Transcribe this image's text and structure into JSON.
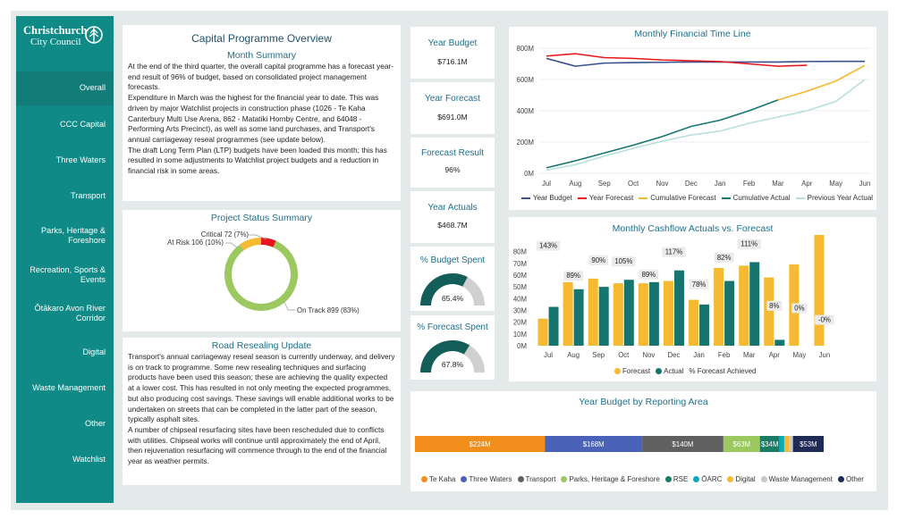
{
  "brand": {
    "line1": "Christchurch",
    "line2": "City Council"
  },
  "nav": [
    {
      "label": "Overall",
      "active": true
    },
    {
      "label": "CCC Capital"
    },
    {
      "label": "Three Waters"
    },
    {
      "label": "Transport"
    },
    {
      "label": "Parks, Heritage & Foreshore"
    },
    {
      "label": "Recreation, Sports & Events"
    },
    {
      "label": "Ōtākaro Avon River Corridor"
    },
    {
      "label": "Digital"
    },
    {
      "label": "Waste Management"
    },
    {
      "label": "Other"
    },
    {
      "label": "Watchlist"
    }
  ],
  "overview": {
    "title": "Capital Programme Overview",
    "month_summary_title": "Month Summary",
    "p1": "At the end of the third quarter, the overall capital programme has a forecast year-end result of 96% of budget, based on consolidated project management forecasts.",
    "p2": "Expenditure in March was the highest for the financial year to date. This was driven by major Watchlist projects in construction phase (1026 - Te Kaha Canterbury Multi Use Arena, 862 - Matatiki Hornby Centre, and 64048 - Performing Arts Precinct), as well as some land purchases, and Transport's annual carriageway reseal programmes (see update below).",
    "p3": "The draft Long Term Plan (LTP) budgets have been loaded this month; this has resulted in some adjustments to Watchlist project budgets and a reduction in financial risk in some areas."
  },
  "project_status": {
    "title": "Project Status Summary",
    "labels": {
      "critical": "Critical 72 (7%)",
      "at_risk": "At Risk 106 (10%)",
      "on_track": "On Track 899 (83%)"
    },
    "values": {
      "on_track": 899,
      "at_risk": 106,
      "critical": 72
    },
    "colors": {
      "on_track": "#9bc85f",
      "at_risk": "#f5b932",
      "critical": "#e8161c"
    }
  },
  "road": {
    "title": "Road Resealing Update",
    "p1": "Transport's annual carriageway reseal season is currently underway, and delivery is on track to programme. Some new resealing techniques and surfacing products have been used this season; these are achieving the quality expected at a lower cost. This has resulted in not only meeting the expected programmes, but also producing cost savings. These savings will enable additional works to be undertaken on streets that can be completed in the latter part of the season, typically asphalt sites.",
    "p2": "A number of chipseal resurfacing sites have been rescheduled due to conflicts with utilities. Chipseal works will continue until approximately the end of April, then rejuvenation resurfacing will commence through to the end of the financial year as weather permits."
  },
  "kpis": {
    "year_budget_label": "Year Budget",
    "year_budget": "$716.1M",
    "year_forecast_label": "Year Forecast",
    "year_forecast": "$691.0M",
    "forecast_result_label": "Forecast Result",
    "forecast_result": "96%",
    "year_actuals_label": "Year Actuals",
    "year_actuals": "$468.7M",
    "budget_spent_label": "% Budget Spent",
    "budget_spent": "65.4%",
    "budget_spent_fraction": 0.654,
    "forecast_spent_label": "% Forecast Spent",
    "forecast_spent": "67.8%",
    "forecast_spent_fraction": 0.678
  },
  "colors": {
    "teal": "#0f8a86",
    "dark_teal": "#135e59",
    "gauge_track": "#d0d0d0",
    "title_blue": "#1f6f8b"
  },
  "chart_data": [
    {
      "type": "line",
      "title": "Monthly Financial Time Line",
      "categories": [
        "Jul",
        "Aug",
        "Sep",
        "Oct",
        "Nov",
        "Dec",
        "Jan",
        "Feb",
        "Mar",
        "Apr",
        "May",
        "Jun"
      ],
      "ylim": [
        0,
        800
      ],
      "yticks": [
        "0M",
        "200M",
        "400M",
        "600M",
        "800M"
      ],
      "ytick_values": [
        0,
        200,
        400,
        600,
        800
      ],
      "series": [
        {
          "name": "Year Budget",
          "color": "#3a4f8c",
          "values": [
            735,
            685,
            705,
            708,
            710,
            712,
            712,
            712,
            712,
            715,
            716,
            716
          ]
        },
        {
          "name": "Year Forecast",
          "color": "#e8161c",
          "values": [
            750,
            765,
            740,
            735,
            725,
            720,
            715,
            700,
            685,
            691,
            null,
            null
          ]
        },
        {
          "name": "Cumulative Forecast",
          "color": "#f5b932",
          "values": [
            null,
            null,
            null,
            null,
            null,
            null,
            null,
            null,
            469,
            525,
            590,
            690
          ]
        },
        {
          "name": "Cumulative Actual",
          "color": "#16756f",
          "values": [
            35,
            80,
            130,
            180,
            235,
            300,
            340,
            400,
            469,
            null,
            null,
            null
          ]
        },
        {
          "name": "Previous Year Actual",
          "color": "#b6e0dc",
          "values": [
            20,
            55,
            110,
            160,
            205,
            245,
            270,
            320,
            360,
            400,
            460,
            600
          ]
        }
      ]
    },
    {
      "type": "bar",
      "title": "Monthly Cashflow Actuals vs. Forecast",
      "categories": [
        "Jul",
        "Aug",
        "Sep",
        "Oct",
        "Nov",
        "Dec",
        "Jan",
        "Feb",
        "Mar",
        "Apr",
        "May",
        "Jun"
      ],
      "ylim": [
        0,
        85
      ],
      "yticks": [
        "0M",
        "10M",
        "20M",
        "30M",
        "40M",
        "50M",
        "60M",
        "70M",
        "80M"
      ],
      "ytick_values": [
        0,
        10,
        20,
        30,
        40,
        50,
        60,
        70,
        80
      ],
      "series": [
        {
          "name": "Forecast",
          "color": "#f5b932",
          "values": [
            23,
            54,
            57,
            53,
            53,
            55,
            39,
            66,
            68,
            58,
            69,
            100
          ]
        },
        {
          "name": "Actual",
          "color": "#16756f",
          "values": [
            33,
            48,
            50,
            56,
            54,
            64,
            35,
            55,
            71,
            5,
            null,
            null
          ]
        }
      ],
      "pct_series_name": "% Forecast Achieved",
      "pct_labels": [
        "143%",
        "89%",
        "90%",
        "105%",
        "89%",
        "117%",
        "78%",
        "82%",
        "111%",
        "8%",
        "0%",
        "-0%"
      ]
    },
    {
      "type": "stacked-bar",
      "title": "Year Budget by Reporting Area",
      "segments": [
        {
          "name": "Te Kaha",
          "value": 224,
          "label": "$224M",
          "color": "#f28e1c"
        },
        {
          "name": "Three Waters",
          "value": 168,
          "label": "$168M",
          "color": "#4a63b8"
        },
        {
          "name": "Transport",
          "value": 140,
          "label": "$140M",
          "color": "#606060"
        },
        {
          "name": "Parks, Heritage & Foreshore",
          "value": 63,
          "label": "$63M",
          "color": "#9bc85f"
        },
        {
          "name": "RSE",
          "value": 34,
          "label": "$34M",
          "color": "#1b7b67"
        },
        {
          "name": "ŌARC",
          "value": 8,
          "label": "",
          "color": "#0aa9b8"
        },
        {
          "name": "Digital",
          "value": 9,
          "label": "",
          "color": "#f5b932"
        },
        {
          "name": "Waste Management",
          "value": 6,
          "label": "",
          "color": "#c8c8c8"
        },
        {
          "name": "Other",
          "value": 53,
          "label": "$53M",
          "color": "#1f2a55"
        }
      ]
    }
  ]
}
